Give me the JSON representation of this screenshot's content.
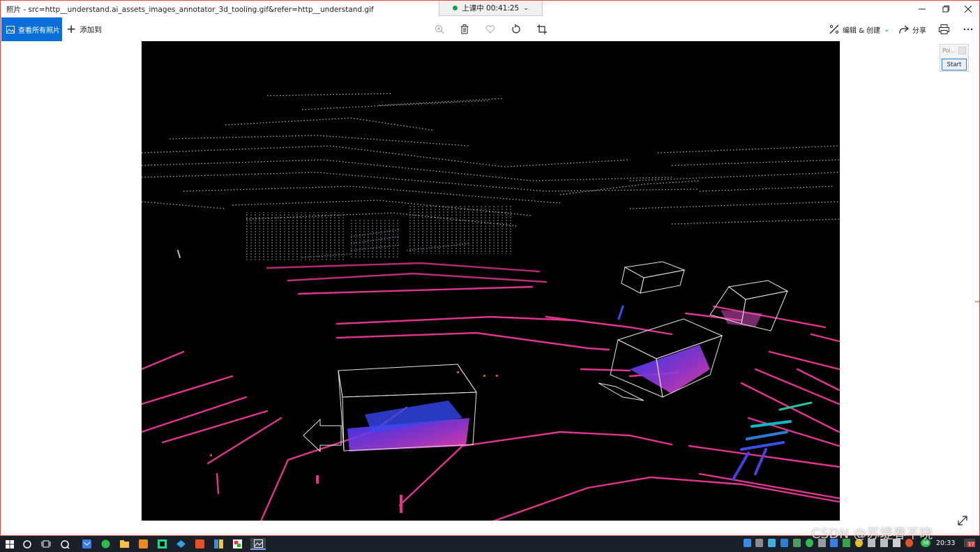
{
  "window": {
    "title": "照片 - src=http__understand.ai_assets_images_annotator_3d_tooling.gif&refer=http__understand.gif",
    "minimize_icon": "minimize-icon",
    "maximize_icon": "maximize-icon",
    "close_icon": "close-icon"
  },
  "recording": {
    "label": "上课中 00:41:25",
    "status_color": "#1aa34a"
  },
  "toolbar": {
    "view_all_label": "查看所有照片",
    "add_to_label": "添加到",
    "zoom_icon": "zoom-in-icon",
    "delete_icon": "trash-icon",
    "favorite_icon": "heart-icon",
    "rotate_icon": "rotate-icon",
    "crop_icon": "crop-icon",
    "edit_create_label": "编辑 & 创建",
    "share_label": "分享",
    "print_icon": "print-icon",
    "more_icon": "more-icon",
    "accent_color": "#0a6fd8"
  },
  "mini_window": {
    "title": "Poi...",
    "start_label": "Start"
  },
  "image": {
    "description_color_lidar": "#e0358f",
    "box_color": "#e8e8e8"
  },
  "taskbar": {
    "time": "20:33",
    "notification_badge": "17",
    "tray_badge": "38"
  },
  "watermark": "CSDN @苏堤春不晓"
}
